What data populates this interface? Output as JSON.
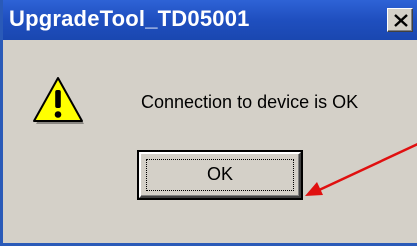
{
  "window": {
    "title": "UpgradeTool_TD05001",
    "close_symbol": "X"
  },
  "dialog": {
    "icon": "warning-icon",
    "message": "Connection to device is OK",
    "ok_label": "OK"
  },
  "annotation": {
    "arrow_color": "#e01010"
  },
  "colors": {
    "titlebar": "#1f4fbf",
    "dialog_background": "#d4d0c8"
  }
}
